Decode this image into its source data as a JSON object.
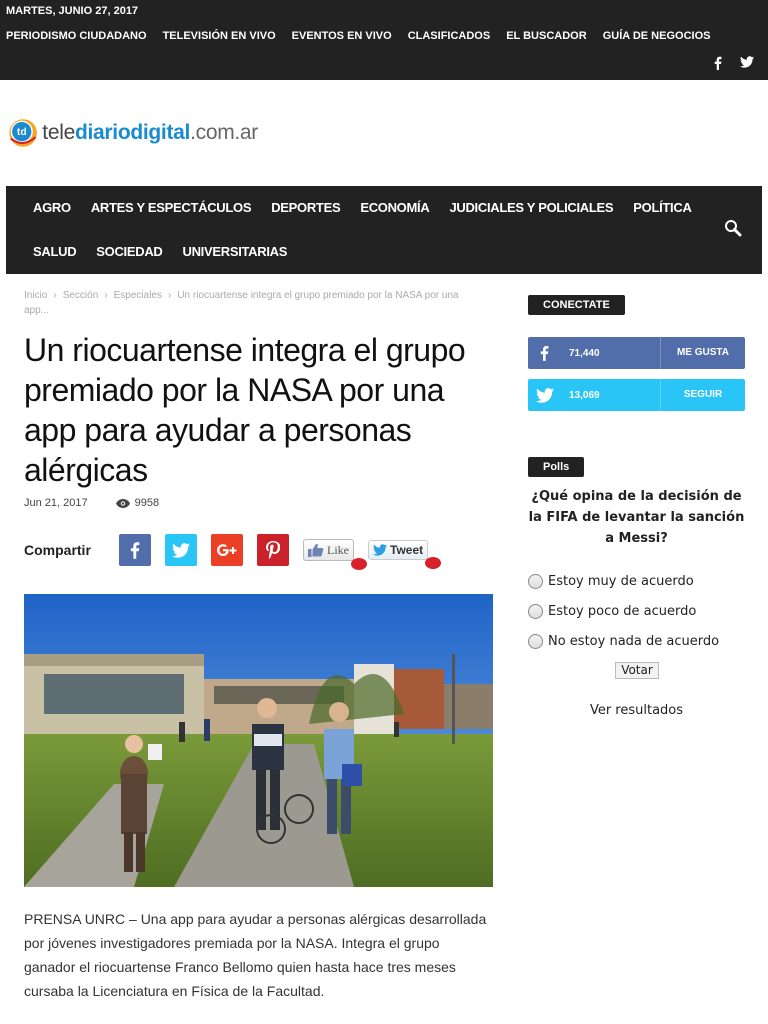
{
  "topbar": {
    "date": "MARTES, JUNIO 27, 2017",
    "menu": [
      "PERIODISMO CIUDADANO",
      "TELEVISIÓN EN VIVO",
      "EVENTOS EN VIVO",
      "CLASIFICADOS",
      "EL BUSCADOR",
      "GUÍA DE NEGOCIOS"
    ],
    "social_icons": [
      "facebook-icon",
      "twitter-icon"
    ]
  },
  "logo": {
    "mark": "td",
    "part1": "tele",
    "part2": "diariodigital",
    "part3": ".com.ar"
  },
  "nav": {
    "items": [
      "AGRO",
      "ARTES Y ESPECTÁCULOS",
      "DEPORTES",
      "ECONOMÍA",
      "JUDICIALES Y POLICIALES",
      "POLÍTICA",
      "SALUD",
      "SOCIEDAD",
      "UNIVERSITARIAS"
    ],
    "search_icon": "search-icon"
  },
  "breadcrumb": [
    "Inicio",
    "Sección",
    "Especiales",
    "Un riocuartense integra el grupo premiado por la NASA por una app..."
  ],
  "article": {
    "title": "Un riocuartense integra el grupo premiado por la NASA por una app para ayudar a personas alérgicas",
    "date": "Jun 21, 2017",
    "views": "9958",
    "share_label": "Compartir",
    "like_label": "Like",
    "tweet_label": "Tweet",
    "body": "PRENSA UNRC – Una app para ayudar a personas alérgicas desarrollada por jóvenes investigadores premiada por la NASA. Integra el grupo ganador el riocuartense Franco Bellomo quien hasta hace tres meses cursaba la Licenciatura en Física de la Facultad."
  },
  "sidebar": {
    "connect_title": "CONECTATE",
    "facebook": {
      "count": "71,440",
      "action": "ME GUSTA"
    },
    "twitter": {
      "count": "13,069",
      "action": "SEGUIR"
    },
    "polls_title": "Polls",
    "poll_question": "¿Qué opina de la decisión de la FIFA de levantar la sanción a Messi?",
    "poll_options": [
      "Estoy muy de acuerdo",
      "Estoy poco de acuerdo",
      "No estoy nada de acuerdo"
    ],
    "vote_label": "Votar",
    "results_label": "Ver resultados"
  },
  "colors": {
    "dark": "#222222",
    "facebook": "#516eab",
    "twitter": "#29c5f6",
    "googleplus": "#eb4026",
    "pinterest": "#ca212a",
    "brand_blue": "#1a8ad1"
  }
}
